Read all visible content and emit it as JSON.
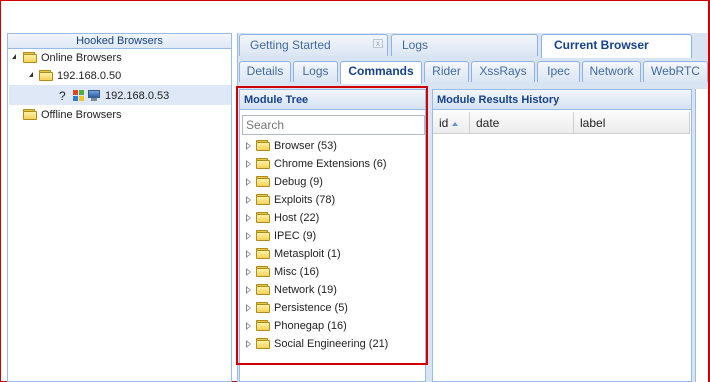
{
  "left_panel": {
    "title": "Hooked Browsers",
    "tree": {
      "online": "Online Browsers",
      "host_group": "192.168.0.50",
      "host": "192.168.0.53",
      "host_icon_os": "windows-icon",
      "host_icon_unknown": "?",
      "offline": "Offline Browsers"
    }
  },
  "main_tabs": [
    {
      "label": "Getting Started",
      "close": "x"
    },
    {
      "label": "Logs"
    },
    {
      "label": "Current Browser",
      "active": true
    }
  ],
  "sub_tabs": [
    {
      "label": "Details"
    },
    {
      "label": "Logs"
    },
    {
      "label": "Commands",
      "active": true
    },
    {
      "label": "Rider"
    },
    {
      "label": "XssRays"
    },
    {
      "label": "Ipec"
    },
    {
      "label": "Network"
    },
    {
      "label": "WebRTC"
    }
  ],
  "module_tree": {
    "title": "Module Tree",
    "search_placeholder": "Search",
    "items": [
      {
        "label": "Browser (53)"
      },
      {
        "label": "Chrome Extensions (6)"
      },
      {
        "label": "Debug (9)"
      },
      {
        "label": "Exploits (78)"
      },
      {
        "label": "Host (22)"
      },
      {
        "label": "IPEC (9)"
      },
      {
        "label": "Metasploit (1)"
      },
      {
        "label": "Misc (16)"
      },
      {
        "label": "Network (19)"
      },
      {
        "label": "Persistence (5)"
      },
      {
        "label": "Phonegap (16)"
      },
      {
        "label": "Social Engineering (21)"
      }
    ]
  },
  "results": {
    "title": "Module Results History",
    "columns": [
      "id",
      "date",
      "label"
    ]
  },
  "colors": {
    "highlight": "#d00000",
    "header_text": "#15428b",
    "border": "#99bbe8"
  }
}
